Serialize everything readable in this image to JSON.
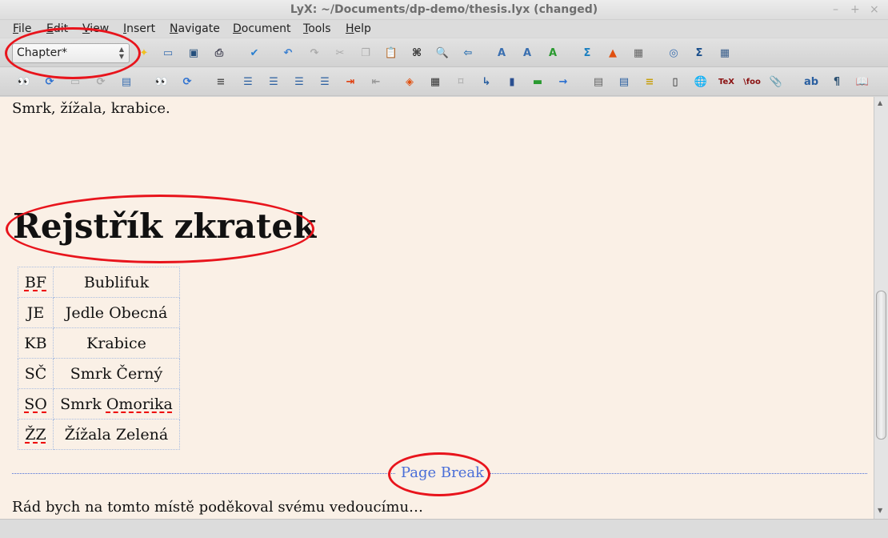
{
  "window": {
    "title": "LyX: ~/Documents/dp-demo/thesis.lyx (changed)",
    "minimize": "–",
    "maximize": "+",
    "close": "×"
  },
  "menu": [
    {
      "u": "F",
      "rest": "ile"
    },
    {
      "u": "E",
      "rest": "dit"
    },
    {
      "u": "V",
      "rest": "iew"
    },
    {
      "u": "I",
      "rest": "nsert"
    },
    {
      "u": "N",
      "rest": "avigate"
    },
    {
      "u": "D",
      "rest": "ocument"
    },
    {
      "u": "T",
      "rest": "ools"
    },
    {
      "u": "H",
      "rest": "elp"
    }
  ],
  "toolbar1": {
    "layout_value": "Chapter*",
    "icons": [
      {
        "name": "new-document-icon",
        "g": "✦",
        "c": "#f0c020"
      },
      {
        "name": "open-document-icon",
        "g": "▭",
        "c": "#3a6fb0"
      },
      {
        "name": "save-icon",
        "g": "▣",
        "c": "#244f7c"
      },
      {
        "name": "print-icon",
        "g": "⎙",
        "c": "#445"
      },
      {
        "name": "spellcheck-icon",
        "g": "✔",
        "c": "#2a7fd0"
      },
      {
        "name": "undo-icon",
        "g": "↶",
        "c": "#3a7fd0"
      },
      {
        "name": "redo-icon",
        "g": "↷",
        "c": "#aaa"
      },
      {
        "name": "cut-icon",
        "g": "✂",
        "c": "#aaa"
      },
      {
        "name": "copy-icon",
        "g": "❐",
        "c": "#aaa"
      },
      {
        "name": "paste-icon",
        "g": "📋",
        "c": "#c89020"
      },
      {
        "name": "find-icon",
        "g": "⌘",
        "c": "#222"
      },
      {
        "name": "find-replace-icon",
        "g": "🔍",
        "c": "#2a6fb0"
      },
      {
        "name": "back-icon",
        "g": "⇦",
        "c": "#2a6fb0"
      },
      {
        "name": "emphasis-icon",
        "g": "A",
        "c": "#3a6fb0"
      },
      {
        "name": "noun-icon",
        "g": "A",
        "c": "#3a6fb0"
      },
      {
        "name": "apply-style-icon",
        "g": "A",
        "c": "#2a9a30"
      },
      {
        "name": "math-icon",
        "g": "Σ",
        "c": "#1a7fc0"
      },
      {
        "name": "insert-graphics-icon",
        "g": "▲",
        "c": "#e05010"
      },
      {
        "name": "insert-table-icon",
        "g": "▦",
        "c": "#666"
      },
      {
        "name": "navigator-icon",
        "g": "◎",
        "c": "#3a6fb0"
      },
      {
        "name": "math-panel-icon",
        "g": "Σ",
        "c": "#1a4f8c"
      },
      {
        "name": "table-panel-icon",
        "g": "▦",
        "c": "#3a5f8c"
      }
    ]
  },
  "toolbar2": {
    "icons": [
      {
        "name": "view-icon",
        "g": "👀",
        "c": "#222"
      },
      {
        "name": "update-icon",
        "g": "⟳",
        "c": "#2a6fd0"
      },
      {
        "name": "view-master-icon",
        "g": "▭",
        "c": "#aaa"
      },
      {
        "name": "update-master-icon",
        "g": "⟳",
        "c": "#aaa"
      },
      {
        "name": "export-icon",
        "g": "▤",
        "c": "#3a6fb0"
      },
      {
        "name": "view-other-icon",
        "g": "👀",
        "c": "#444"
      },
      {
        "name": "update-other-icon",
        "g": "⟳",
        "c": "#2a6fd0"
      },
      {
        "name": "paragraph-standard-icon",
        "g": "≡",
        "c": "#555"
      },
      {
        "name": "enumerate-icon",
        "g": "☰",
        "c": "#2a5fa0"
      },
      {
        "name": "itemize-icon",
        "g": "☰",
        "c": "#2a5fa0"
      },
      {
        "name": "description-icon",
        "g": "☰",
        "c": "#2a5fa0"
      },
      {
        "name": "list-icon",
        "g": "☰",
        "c": "#2a5fa0"
      },
      {
        "name": "increase-depth-icon",
        "g": "⇥",
        "c": "#e04010"
      },
      {
        "name": "decrease-depth-icon",
        "g": "⇤",
        "c": "#999"
      },
      {
        "name": "float-figure-icon",
        "g": "◈",
        "c": "#e05010"
      },
      {
        "name": "float-table-icon",
        "g": "▦",
        "c": "#333"
      },
      {
        "name": "label-icon",
        "g": "⌑",
        "c": "#aaa"
      },
      {
        "name": "cross-reference-icon",
        "g": "↳",
        "c": "#2a5fa0"
      },
      {
        "name": "bookmark-icon",
        "g": "▮",
        "c": "#2a4f90"
      },
      {
        "name": "index-entry-icon",
        "g": "▬",
        "c": "#2a9a30"
      },
      {
        "name": "nomenclature-icon",
        "g": "→",
        "c": "#2a6fd0"
      },
      {
        "name": "footnote-icon",
        "g": "▤",
        "c": "#666"
      },
      {
        "name": "margin-note-icon",
        "g": "▤",
        "c": "#2a5fa0"
      },
      {
        "name": "note-icon",
        "g": "≡",
        "c": "#c8a010"
      },
      {
        "name": "box-icon",
        "g": "▯",
        "c": "#222"
      },
      {
        "name": "hyperlink-icon",
        "g": "🌐",
        "c": "#3a8a30"
      },
      {
        "name": "tex-code-icon",
        "g": "TeX",
        "c": "#8a1010"
      },
      {
        "name": "command-icon",
        "g": "\\foo",
        "c": "#8a1010"
      },
      {
        "name": "attach-icon",
        "g": "📎",
        "c": "#999"
      },
      {
        "name": "font-change-icon",
        "g": "ab",
        "c": "#2a5fa0"
      },
      {
        "name": "paragraph-settings-icon",
        "g": "¶",
        "c": "#2a4f70"
      },
      {
        "name": "toc-icon",
        "g": "📖",
        "c": "#a02020"
      }
    ]
  },
  "document": {
    "paragraph1": "Smrk, žížala, krabice.",
    "heading": "Rejstřík zkratek",
    "table": [
      [
        "BF",
        "Bublifuk"
      ],
      [
        "JE",
        "Jedle Obecná"
      ],
      [
        "KB",
        "Krabice"
      ],
      [
        "SČ",
        "Smrk Černý"
      ],
      [
        "SO",
        "Smrk Omorika"
      ],
      [
        "ŽZ",
        "Žížala Zelená"
      ]
    ],
    "page_break": "Page Break",
    "paragraph2": "Rád bych na tomto místě poděkoval svému vedoucímu…"
  }
}
